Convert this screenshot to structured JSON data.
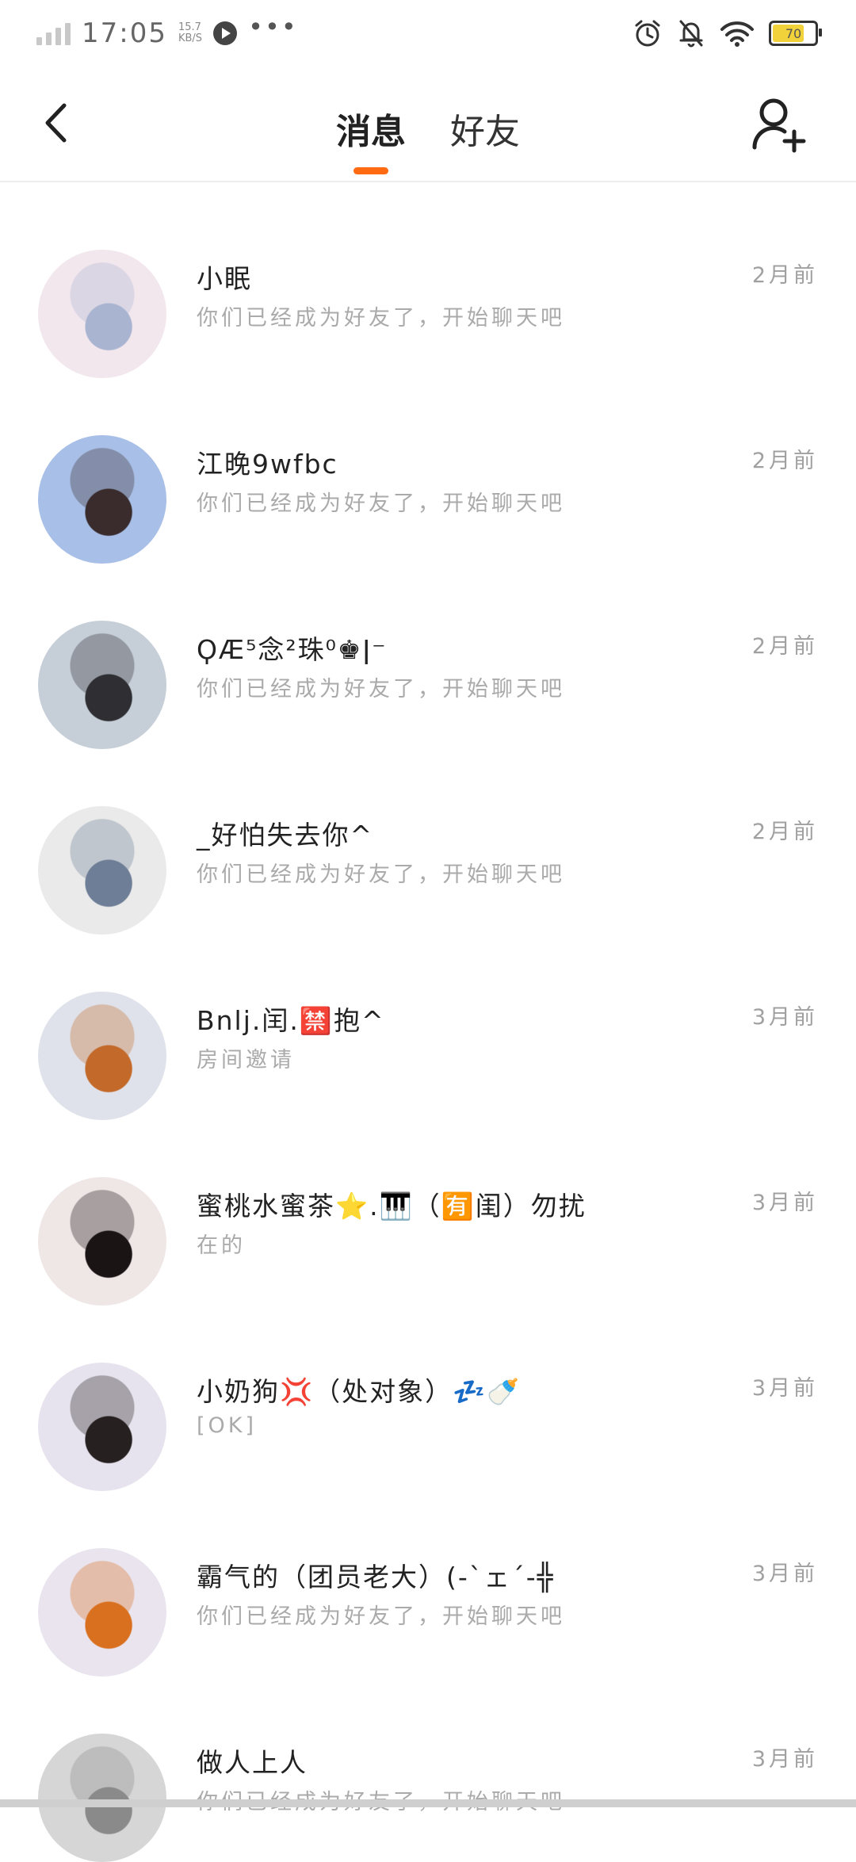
{
  "status_bar": {
    "time": "17:05",
    "speed_value": "15.7",
    "speed_unit": "KB/S",
    "battery": "70",
    "battery_level": 0.7
  },
  "header": {
    "tabs": [
      "消息",
      "好友"
    ],
    "active_tab": 0
  },
  "conversations": [
    {
      "name": "小眠",
      "preview": "你们已经成为好友了，开始聊天吧",
      "time": "2月前",
      "avatar_colors": [
        "#f3e7ee",
        "#a9b4d0"
      ]
    },
    {
      "name": "江晚9wfbc",
      "preview": "你们已经成为好友了，开始聊天吧",
      "time": "2月前",
      "avatar_colors": [
        "#a8bfe8",
        "#3a2c2c"
      ]
    },
    {
      "name": "ϘÆ⁵念²珠⁰♚ǀ⁻",
      "preview": "你们已经成为好友了，开始聊天吧",
      "time": "2月前",
      "avatar_colors": [
        "#c6ced8",
        "#2f2f33"
      ]
    },
    {
      "name": "_好怕失去你^",
      "preview": "你们已经成为好友了，开始聊天吧",
      "time": "2月前",
      "avatar_colors": [
        "#eaeaea",
        "#6d7e96"
      ]
    },
    {
      "name": "Bnlj.闰.🈲抱^",
      "preview": "房间邀请",
      "time": "3月前",
      "avatar_colors": [
        "#dfe2ea",
        "#c36a2b"
      ]
    },
    {
      "name": "蜜桃水蜜茶⭐.🎹（🈶闺）勿扰",
      "preview": "在的",
      "time": "3月前",
      "avatar_colors": [
        "#efe6e6",
        "#1a1414"
      ]
    },
    {
      "name": "小奶狗💢（处对象）💤🍼",
      "preview": "[OK]",
      "time": "3月前",
      "avatar_colors": [
        "#e7e3ee",
        "#262020"
      ]
    },
    {
      "name": "霸气的（团员老大）(-`ェ´-╬",
      "preview": "你们已经成为好友了，开始聊天吧",
      "time": "3月前",
      "avatar_colors": [
        "#e9e4ee",
        "#d8701f"
      ]
    },
    {
      "name": "做人上人",
      "preview": "你们已经成为好友了，开始聊天吧",
      "time": "3月前",
      "avatar_colors": [
        "#d6d6d6",
        "#8a8a8a"
      ]
    }
  ],
  "icons": {
    "back": "chevron-left-icon",
    "add_friend": "add-person-icon",
    "alarm": "alarm-icon",
    "mute": "bell-off-icon",
    "wifi": "wifi-icon",
    "battery": "battery-icon"
  },
  "accent_color": "#ff6a13"
}
